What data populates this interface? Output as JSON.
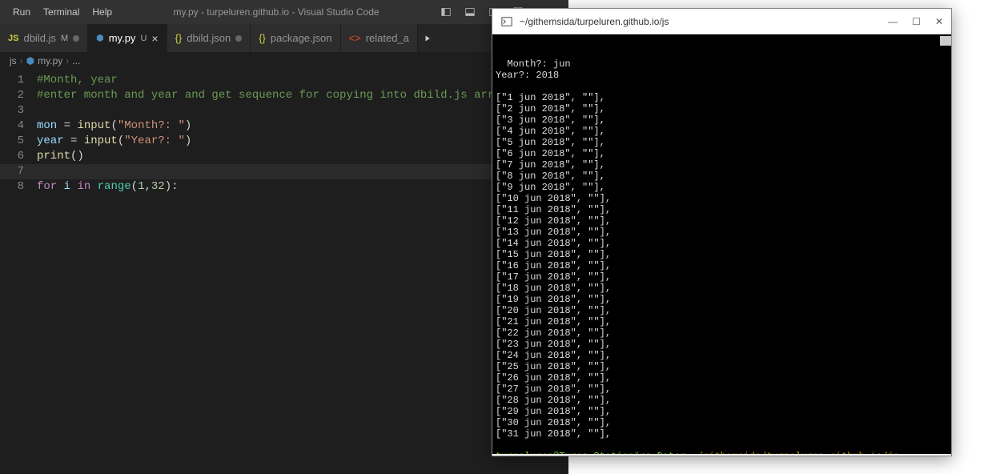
{
  "vscode": {
    "menu": [
      "Run",
      "Terminal",
      "Help"
    ],
    "title": "my.py - turpeluren.github.io - Visual Studio Code",
    "tabs": [
      {
        "icon": "js",
        "label": "dbild.js",
        "badge": "M",
        "mod": "dim"
      },
      {
        "icon": "py",
        "label": "my.py",
        "badge": "U",
        "active": true,
        "close": true
      },
      {
        "icon": "json",
        "label": "dbild.json",
        "mod": "dim"
      },
      {
        "icon": "json",
        "label": "package.json"
      },
      {
        "icon": "html",
        "label": "related_a"
      }
    ],
    "breadcrumb": [
      "js",
      "my.py",
      "..."
    ],
    "code": [
      {
        "n": 1,
        "tokens": [
          [
            "comment",
            "#Month, year"
          ]
        ]
      },
      {
        "n": 2,
        "tokens": [
          [
            "comment",
            "#enter month and year and get sequence for copying into dbild.js array"
          ]
        ]
      },
      {
        "n": 3,
        "tokens": []
      },
      {
        "n": 4,
        "tokens": [
          [
            "var",
            "mon"
          ],
          [
            "",
            " = "
          ],
          [
            "func",
            "input"
          ],
          [
            "",
            "("
          ],
          [
            "str",
            "\"Month?: \""
          ],
          [
            "",
            ")"
          ]
        ]
      },
      {
        "n": 5,
        "tokens": [
          [
            "var",
            "year"
          ],
          [
            "",
            " = "
          ],
          [
            "func",
            "input"
          ],
          [
            "",
            "("
          ],
          [
            "str",
            "\"Year?: \""
          ],
          [
            "",
            ")"
          ]
        ]
      },
      {
        "n": 6,
        "tokens": [
          [
            "func",
            "print"
          ],
          [
            "",
            "()"
          ]
        ]
      },
      {
        "n": 7,
        "tokens": [],
        "cursor": true
      },
      {
        "n": 8,
        "tokens": [
          [
            "kw",
            "for"
          ],
          [
            "",
            " "
          ],
          [
            "var",
            "i"
          ],
          [
            "",
            " "
          ],
          [
            "kw",
            "in"
          ],
          [
            "",
            " "
          ],
          [
            "builtin",
            "range"
          ],
          [
            "",
            "("
          ],
          [
            "num",
            "1"
          ],
          [
            "",
            ","
          ],
          [
            "num",
            "32"
          ],
          [
            "",
            "):"
          ]
        ]
      }
    ]
  },
  "terminal": {
    "title": "~/githemsida/turpeluren.github.io/js",
    "input_month_prompt": "Month?: ",
    "input_month_val": "jun",
    "input_year_prompt": "Year?: ",
    "input_year_val": "2018",
    "days": [
      1,
      2,
      3,
      4,
      5,
      6,
      7,
      8,
      9,
      10,
      11,
      12,
      13,
      14,
      15,
      16,
      17,
      18,
      19,
      20,
      21,
      22,
      23,
      24,
      25,
      26,
      27,
      28,
      29,
      30,
      31
    ],
    "month": "jun",
    "year": "2018",
    "prompt_user": "turpeluren@Tures-Stationära-Dator",
    "prompt_path": "~/githemsida/turpeluren.github.io/js",
    "prompt_char": "$"
  }
}
